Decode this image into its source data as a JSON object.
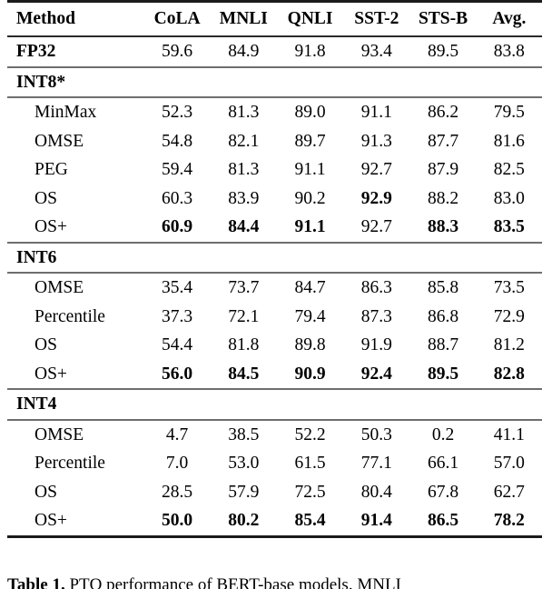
{
  "table": {
    "columns": [
      "Method",
      "CoLA",
      "MNLI",
      "QNLI",
      "SST-2",
      "STS-B",
      "Avg."
    ],
    "rows": [
      {
        "kind": "baseline",
        "label": "FP32",
        "label_bold": true,
        "values": [
          "59.6",
          "84.9",
          "91.8",
          "93.4",
          "89.5",
          "83.8"
        ],
        "bold": [
          false,
          false,
          false,
          false,
          false,
          false
        ]
      },
      {
        "kind": "group",
        "label": "INT8*",
        "label_bold": true,
        "values": [
          "",
          "",
          "",
          "",
          "",
          ""
        ],
        "bold": [
          false,
          false,
          false,
          false,
          false,
          false
        ]
      },
      {
        "kind": "data",
        "label": "MinMax",
        "label_bold": false,
        "values": [
          "52.3",
          "81.3",
          "89.0",
          "91.1",
          "86.2",
          "79.5"
        ],
        "bold": [
          false,
          false,
          false,
          false,
          false,
          false
        ]
      },
      {
        "kind": "data",
        "label": "OMSE",
        "label_bold": false,
        "values": [
          "54.8",
          "82.1",
          "89.7",
          "91.3",
          "87.7",
          "81.6"
        ],
        "bold": [
          false,
          false,
          false,
          false,
          false,
          false
        ]
      },
      {
        "kind": "data",
        "label": "PEG",
        "label_bold": false,
        "values": [
          "59.4",
          "81.3",
          "91.1",
          "92.7",
          "87.9",
          "82.5"
        ],
        "bold": [
          false,
          false,
          false,
          false,
          false,
          false
        ]
      },
      {
        "kind": "data",
        "label": "OS",
        "label_bold": false,
        "values": [
          "60.3",
          "83.9",
          "90.2",
          "92.9",
          "88.2",
          "83.0"
        ],
        "bold": [
          false,
          false,
          false,
          true,
          false,
          false
        ]
      },
      {
        "kind": "data",
        "label": "OS+",
        "label_bold": false,
        "values": [
          "60.9",
          "84.4",
          "91.1",
          "92.7",
          "88.3",
          "83.5"
        ],
        "bold": [
          true,
          true,
          true,
          false,
          true,
          true
        ]
      },
      {
        "kind": "group",
        "label": "INT6",
        "label_bold": true,
        "values": [
          "",
          "",
          "",
          "",
          "",
          ""
        ],
        "bold": [
          false,
          false,
          false,
          false,
          false,
          false
        ]
      },
      {
        "kind": "data",
        "label": "OMSE",
        "label_bold": false,
        "values": [
          "35.4",
          "73.7",
          "84.7",
          "86.3",
          "85.8",
          "73.5"
        ],
        "bold": [
          false,
          false,
          false,
          false,
          false,
          false
        ]
      },
      {
        "kind": "data",
        "label": "Percentile",
        "label_bold": false,
        "values": [
          "37.3",
          "72.1",
          "79.4",
          "87.3",
          "86.8",
          "72.9"
        ],
        "bold": [
          false,
          false,
          false,
          false,
          false,
          false
        ]
      },
      {
        "kind": "data",
        "label": "OS",
        "label_bold": false,
        "values": [
          "54.4",
          "81.8",
          "89.8",
          "91.9",
          "88.7",
          "81.2"
        ],
        "bold": [
          false,
          false,
          false,
          false,
          false,
          false
        ]
      },
      {
        "kind": "data",
        "label": "OS+",
        "label_bold": false,
        "values": [
          "56.0",
          "84.5",
          "90.9",
          "92.4",
          "89.5",
          "82.8"
        ],
        "bold": [
          true,
          true,
          true,
          true,
          true,
          true
        ]
      },
      {
        "kind": "group",
        "label": "INT4",
        "label_bold": true,
        "values": [
          "",
          "",
          "",
          "",
          "",
          ""
        ],
        "bold": [
          false,
          false,
          false,
          false,
          false,
          false
        ]
      },
      {
        "kind": "data",
        "label": "OMSE",
        "label_bold": false,
        "values": [
          "4.7",
          "38.5",
          "52.2",
          "50.3",
          "0.2",
          "41.1"
        ],
        "bold": [
          false,
          false,
          false,
          false,
          false,
          false
        ]
      },
      {
        "kind": "data",
        "label": "Percentile",
        "label_bold": false,
        "values": [
          "7.0",
          "53.0",
          "61.5",
          "77.1",
          "66.1",
          "57.0"
        ],
        "bold": [
          false,
          false,
          false,
          false,
          false,
          false
        ]
      },
      {
        "kind": "data",
        "label": "OS",
        "label_bold": false,
        "values": [
          "28.5",
          "57.9",
          "72.5",
          "80.4",
          "67.8",
          "62.7"
        ],
        "bold": [
          false,
          false,
          false,
          false,
          false,
          false
        ]
      },
      {
        "kind": "data",
        "label": "OS+",
        "label_bold": false,
        "values": [
          "50.0",
          "80.2",
          "85.4",
          "91.4",
          "86.5",
          "78.2"
        ],
        "bold": [
          true,
          true,
          true,
          true,
          true,
          true
        ]
      }
    ]
  },
  "caption": {
    "label": "Table 1.",
    "text": "PTQ performance of BERT-base models. MNLI"
  }
}
